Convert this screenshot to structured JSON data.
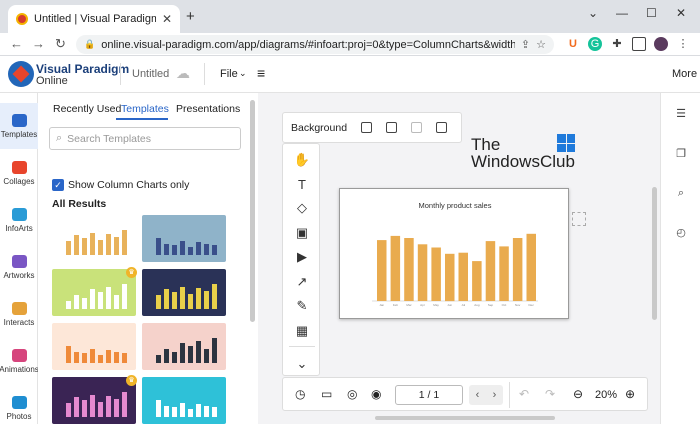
{
  "browser": {
    "tab_title": "Untitled | Visual Paradigm Online",
    "tab_close": "✕",
    "new_tab": "+",
    "url": "online.visual-paradigm.com/app/diagrams/#infoart:proj=0&type=ColumnCharts&width=1...",
    "window_controls": [
      "⌄",
      "—",
      "☐",
      "✕"
    ],
    "nav": [
      "←",
      "→",
      "↻"
    ]
  },
  "app": {
    "brand_line1": "Visual Paradigm",
    "brand_line2": "Online",
    "doc_title": "Untitled",
    "file_menu": "File",
    "more": "More"
  },
  "left_rail": [
    {
      "label": "Templates",
      "color": "#2a66c8",
      "active": true
    },
    {
      "label": "Collages",
      "color": "#e8452c"
    },
    {
      "label": "InfoArts",
      "color": "#2a9bd6"
    },
    {
      "label": "Artworks",
      "color": "#7a56c4"
    },
    {
      "label": "Interacts",
      "color": "#e5a23a"
    },
    {
      "label": "Animations",
      "color": "#d6457d"
    },
    {
      "label": "Photos",
      "color": "#1f8ed1"
    }
  ],
  "panel": {
    "tabs": [
      "Recently Used",
      "Templates",
      "Presentations"
    ],
    "search_placeholder": "Search Templates",
    "checkbox_label": "Show Column Charts only",
    "section": "All Results"
  },
  "thumbnails": [
    {
      "bg": "#ffffff",
      "bar": "#e8b25b",
      "premium": false
    },
    {
      "bg": "#8fb3c9",
      "bar": "#3a4f8a",
      "premium": false
    },
    {
      "bg": "#c9e27a",
      "bar": "#ffffff",
      "premium": true
    },
    {
      "bg": "#2a3257",
      "bar": "#e9d04a",
      "premium": false
    },
    {
      "bg": "#fde7d8",
      "bar": "#ef8a3a",
      "premium": false
    },
    {
      "bg": "#f5d2cb",
      "bar": "#2c3440",
      "premium": false
    },
    {
      "bg": "#3a2454",
      "bar": "#e58ad0",
      "premium": true
    },
    {
      "bg": "#2ec1d8",
      "bar": "#ffffff",
      "premium": false
    }
  ],
  "canvas": {
    "background_label": "Background",
    "watermark_line1": "The",
    "watermark_line2": "WindowsClub",
    "page_indicator": "1 / 1",
    "zoom": "20%"
  },
  "chart_data": {
    "type": "bar",
    "title": "Monthly product sales",
    "categories": [
      "Jan",
      "Feb",
      "Mar",
      "Apr",
      "May",
      "Jun",
      "Jul",
      "Aug",
      "Sep",
      "Oct",
      "Nov",
      "Dec"
    ],
    "values": [
      58,
      62,
      60,
      54,
      51,
      45,
      46,
      38,
      57,
      52,
      60,
      64
    ],
    "ylim": [
      0,
      80
    ],
    "bar_color": "#e9ab4e"
  }
}
